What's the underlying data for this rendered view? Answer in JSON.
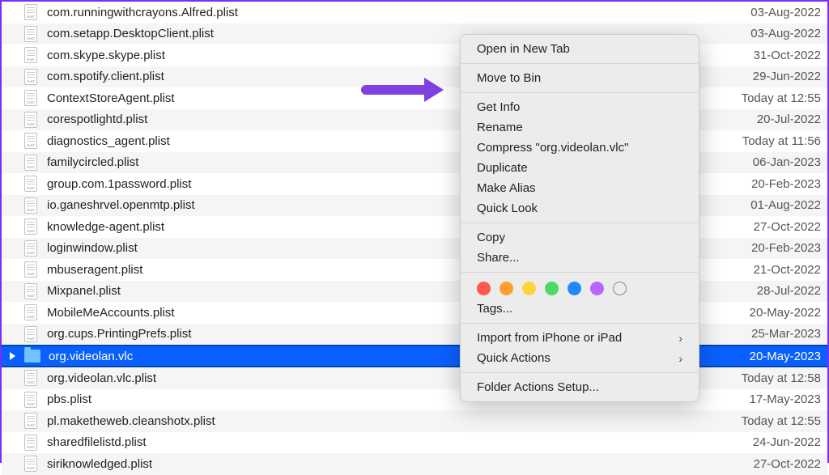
{
  "files": [
    {
      "name": "com.runningwithcrayons.Alfred.plist",
      "date": "03-Aug-2022",
      "type": "plist"
    },
    {
      "name": "com.setapp.DesktopClient.plist",
      "date": "03-Aug-2022",
      "type": "plist"
    },
    {
      "name": "com.skype.skype.plist",
      "date": "31-Oct-2022",
      "type": "plist"
    },
    {
      "name": "com.spotify.client.plist",
      "date": "29-Jun-2022",
      "type": "plist"
    },
    {
      "name": "ContextStoreAgent.plist",
      "date": "Today at 12:55",
      "type": "plist"
    },
    {
      "name": "corespotlightd.plist",
      "date": "20-Jul-2022",
      "type": "plist"
    },
    {
      "name": "diagnostics_agent.plist",
      "date": "Today at 11:56",
      "type": "plist"
    },
    {
      "name": "familycircled.plist",
      "date": "06-Jan-2023",
      "type": "plist"
    },
    {
      "name": "group.com.1password.plist",
      "date": "20-Feb-2023",
      "type": "plist"
    },
    {
      "name": "io.ganeshrvel.openmtp.plist",
      "date": "01-Aug-2022",
      "type": "plist"
    },
    {
      "name": "knowledge-agent.plist",
      "date": "27-Oct-2022",
      "type": "plist"
    },
    {
      "name": "loginwindow.plist",
      "date": "20-Feb-2023",
      "type": "plist"
    },
    {
      "name": "mbuseragent.plist",
      "date": "21-Oct-2022",
      "type": "plist"
    },
    {
      "name": "Mixpanel.plist",
      "date": "28-Jul-2022",
      "type": "plist"
    },
    {
      "name": "MobileMeAccounts.plist",
      "date": "20-May-2022",
      "type": "plist"
    },
    {
      "name": "org.cups.PrintingPrefs.plist",
      "date": "25-Mar-2023",
      "type": "plist"
    },
    {
      "name": "org.videolan.vlc",
      "date": "20-May-2023",
      "type": "folder",
      "selected": true
    },
    {
      "name": "org.videolan.vlc.plist",
      "date": "Today at 12:58",
      "type": "plist"
    },
    {
      "name": "pbs.plist",
      "date": "17-May-2023",
      "type": "plist"
    },
    {
      "name": "pl.maketheweb.cleanshotx.plist",
      "date": "Today at 12:55",
      "type": "plist"
    },
    {
      "name": "sharedfilelistd.plist",
      "date": "24-Jun-2022",
      "type": "plist"
    },
    {
      "name": "siriknowledged.plist",
      "date": "27-Oct-2022",
      "type": "plist"
    }
  ],
  "menu": {
    "open_new_tab": "Open in New Tab",
    "move_to_bin": "Move to Bin",
    "get_info": "Get Info",
    "rename": "Rename",
    "compress": "Compress \"org.videolan.vlc\"",
    "duplicate": "Duplicate",
    "make_alias": "Make Alias",
    "quick_look": "Quick Look",
    "copy": "Copy",
    "share": "Share...",
    "tags": "Tags...",
    "import": "Import from iPhone or iPad",
    "quick_actions": "Quick Actions",
    "folder_actions": "Folder Actions Setup..."
  },
  "tag_colors": [
    "#ff564f",
    "#ff9e2d",
    "#ffd43a",
    "#4cd964",
    "#1f8aff",
    "#b567ff"
  ]
}
